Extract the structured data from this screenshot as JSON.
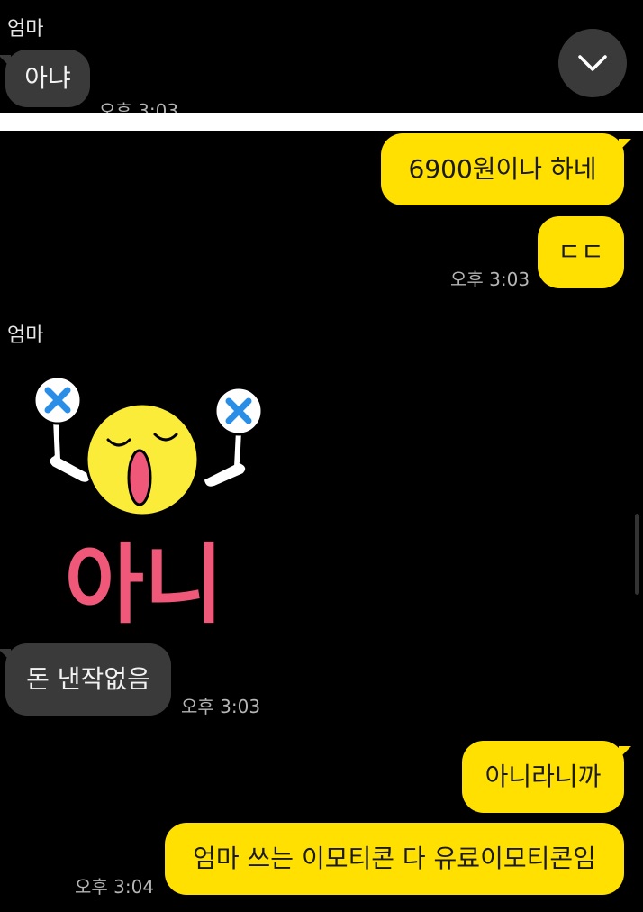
{
  "top": {
    "sender": "엄마",
    "message": "아냐",
    "time": "오후 3:03"
  },
  "chat": {
    "outgoing_1": "6900원이나 하네",
    "outgoing_2": "ㄷㄷ",
    "outgoing_time": "오후 3:03",
    "sender": "엄마",
    "sticker_text": "아니",
    "incoming_msg": "돈 낸작없음",
    "incoming_time": "오후 3:03",
    "outgoing_3": "아니라니까",
    "outgoing_4": "엄마 쓰는 이모티콘 다 유료이모티콘임",
    "outgoing_time_2": "오후 3:04"
  },
  "icons": {
    "scroll_down": "chevron-down-icon",
    "sticker": "sticker-icon"
  },
  "colors": {
    "background": "#000000",
    "outgoing_bubble": "#ffe000",
    "incoming_bubble": "#3a3a3a",
    "sticker_face": "#fcec3a",
    "sticker_text": "#f0587a",
    "sticker_x": "#2a8ee6"
  }
}
